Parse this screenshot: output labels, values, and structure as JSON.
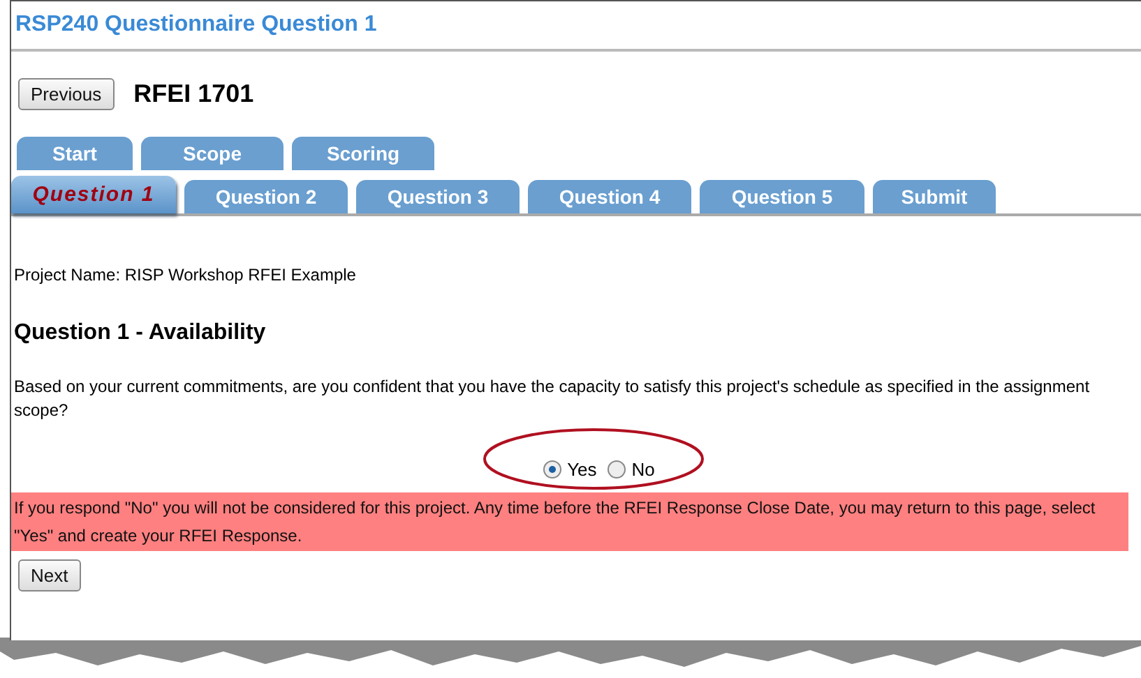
{
  "title": "RSP240 Questionnaire Question 1",
  "previous_button": "Previous",
  "rfei": "RFEI 1701",
  "tab_rows": [
    {
      "tabs": [
        {
          "label": "Start",
          "selected": false
        },
        {
          "label": "Scope",
          "selected": false
        },
        {
          "label": "Scoring",
          "selected": false
        }
      ]
    },
    {
      "tabs": [
        {
          "label": "Question 1",
          "selected": true
        },
        {
          "label": "Question 2",
          "selected": false
        },
        {
          "label": "Question 3",
          "selected": false
        },
        {
          "label": "Question 4",
          "selected": false
        },
        {
          "label": "Question 5",
          "selected": false
        },
        {
          "label": "Submit",
          "selected": false
        }
      ]
    }
  ],
  "project_name": "Project Name: RISP Workshop RFEI Example",
  "heading": {
    "main": "Question 1",
    "sub": "- Availability"
  },
  "question": "Based on your current commitments, are you confident that you have the capacity to satisfy this project's schedule as specified in the assignment scope?",
  "options": [
    {
      "label": "Yes",
      "selected": true
    },
    {
      "label": "No",
      "selected": false
    }
  ],
  "warning": "If you respond \"No\" you will not be considered for this project. Any time before the RFEI Response Close Date, you may return to this page, select \"Yes\" and create your RFEI Response.",
  "next_button": "Next"
}
